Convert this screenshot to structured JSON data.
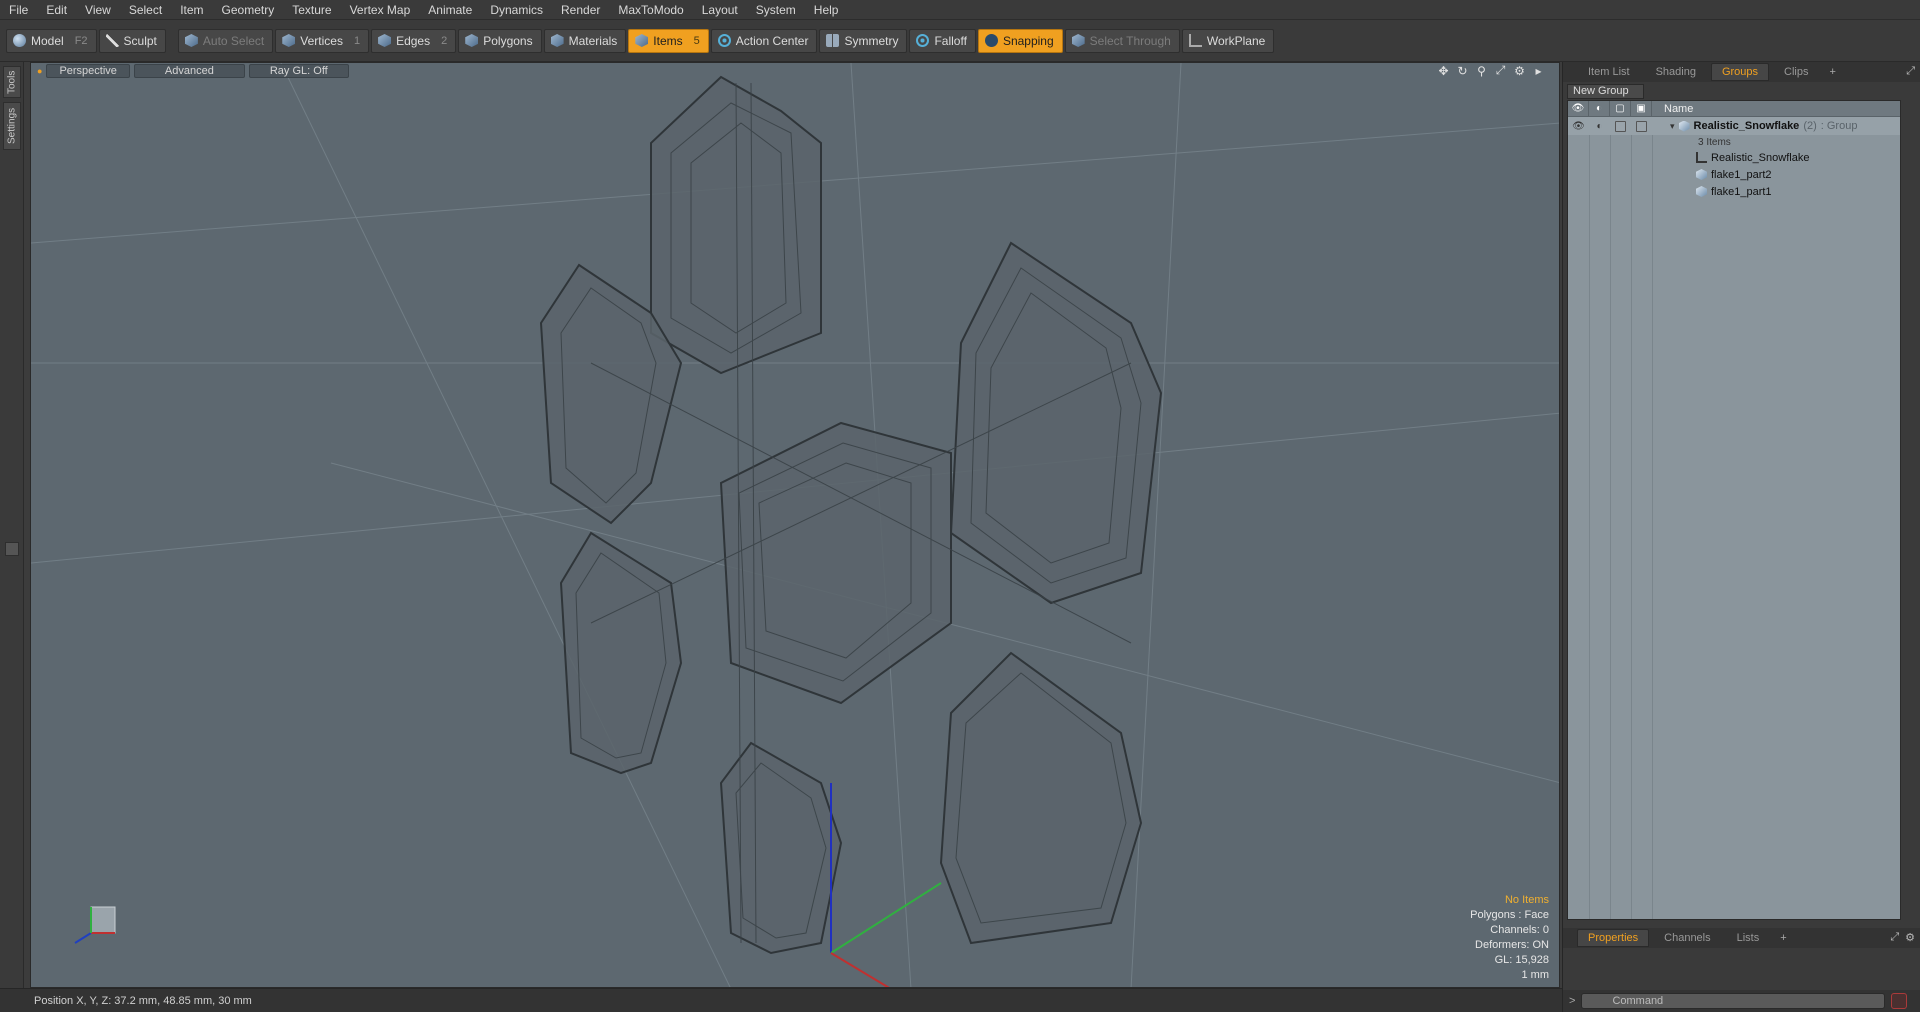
{
  "menu": [
    "File",
    "Edit",
    "View",
    "Select",
    "Item",
    "Geometry",
    "Texture",
    "Vertex Map",
    "Animate",
    "Dynamics",
    "Render",
    "MaxToModo",
    "Layout",
    "System",
    "Help"
  ],
  "toolbar": {
    "model": {
      "label": "Model",
      "key": "F2"
    },
    "sculpt": {
      "label": "Sculpt"
    },
    "auto_select": {
      "label": "Auto Select"
    },
    "vertices": {
      "label": "Vertices",
      "key": "1"
    },
    "edges": {
      "label": "Edges",
      "key": "2"
    },
    "polygons": {
      "label": "Polygons",
      "key": ""
    },
    "materials": {
      "label": "Materials"
    },
    "items": {
      "label": "Items",
      "key": "5"
    },
    "action_center": {
      "label": "Action Center"
    },
    "symmetry": {
      "label": "Symmetry"
    },
    "falloff": {
      "label": "Falloff"
    },
    "snapping": {
      "label": "Snapping"
    },
    "select_through": {
      "label": "Select Through"
    },
    "workplane": {
      "label": "WorkPlane"
    }
  },
  "left_tabs": [
    "Tools",
    "Settings"
  ],
  "viewport": {
    "view_mode": "Perspective",
    "style": "Advanced",
    "raygl": "Ray GL: Off",
    "info": {
      "selection": "No Items",
      "polygons": "Polygons : Face",
      "channels": "Channels: 0",
      "deformers": "Deformers: ON",
      "gl": "GL: 15,928",
      "unit": "1 mm"
    },
    "accent_color": "#f0b030"
  },
  "status": {
    "position": "Position X, Y, Z:   37.2 mm, 48.85 mm, 30 mm"
  },
  "right_panel": {
    "tabs": [
      "Item List",
      "Shading",
      "Groups",
      "Clips"
    ],
    "active_tab": "Groups",
    "new_group": "New Group",
    "column_name": "Name",
    "group": {
      "name": "Realistic_Snowflake",
      "count": "(2)",
      "type": ": Group",
      "items_count": "3 Items"
    },
    "rows": [
      {
        "label": "Realistic_Snowflake",
        "icon": "locator-icon"
      },
      {
        "label": "flake1_part2",
        "icon": "mesh-icon"
      },
      {
        "label": "flake1_part1",
        "icon": "mesh-icon"
      }
    ],
    "bottom_tabs": [
      "Properties",
      "Channels",
      "Lists"
    ],
    "bottom_active": "Properties",
    "command_placeholder": "Command"
  }
}
